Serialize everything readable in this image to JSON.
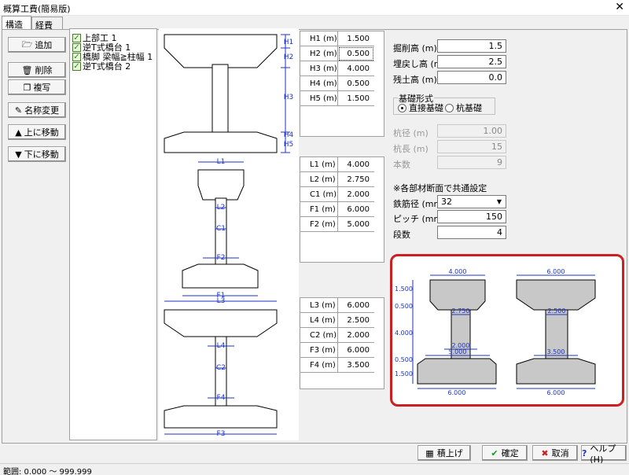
{
  "window": {
    "title": "概算工費(簡易版)",
    "close": "✕"
  },
  "tabs": [
    {
      "label": "構造物"
    },
    {
      "label": "経費率"
    }
  ],
  "buttons": {
    "add": "追加",
    "delete": "削除",
    "copy": "複写",
    "rename": "名称変更",
    "move_up": "上に移動",
    "move_down": "下に移動"
  },
  "tree": [
    {
      "label": "上部工 1"
    },
    {
      "label": "逆T式橋台 1"
    },
    {
      "label": "橋脚 梁幅≧柱幅 1"
    },
    {
      "label": "逆T式橋台 2"
    }
  ],
  "drawing_labels": {
    "h1": "H1",
    "h2": "H2",
    "h3": "H3",
    "h4": "H4",
    "h5": "H5",
    "l1": "L1",
    "l2": "L2",
    "c1": "C1",
    "f2": "F2",
    "f1": "F1",
    "l3": "L3",
    "l4": "L4",
    "c2": "C2",
    "f4": "F4",
    "f3": "F3"
  },
  "table_h": [
    {
      "label": "H1 (m)",
      "value": "1.500"
    },
    {
      "label": "H2 (m)",
      "value": "0.500"
    },
    {
      "label": "H3 (m)",
      "value": "4.000"
    },
    {
      "label": "H4 (m)",
      "value": "0.500"
    },
    {
      "label": "H5 (m)",
      "value": "1.500"
    }
  ],
  "table_l": [
    {
      "label": "L1 (m)",
      "value": "4.000"
    },
    {
      "label": "L2 (m)",
      "value": "2.750"
    },
    {
      "label": "C1 (m)",
      "value": "2.000"
    },
    {
      "label": "F1 (m)",
      "value": "6.000"
    },
    {
      "label": "F2 (m)",
      "value": "5.000"
    }
  ],
  "table_f": [
    {
      "label": "L3 (m)",
      "value": "6.000"
    },
    {
      "label": "L4 (m)",
      "value": "2.500"
    },
    {
      "label": "C2 (m)",
      "value": "2.000"
    },
    {
      "label": "F3 (m)",
      "value": "6.000"
    },
    {
      "label": "F4 (m)",
      "value": "3.500"
    }
  ],
  "fields": {
    "excavation_label": "掘削高 (m)",
    "excavation": "1.5",
    "backfill_label": "埋戻し高 (m)",
    "backfill": "2.5",
    "residual_label": "残土高 (m)",
    "residual": "0.0",
    "foundation_group": "基礎形式",
    "direct_label": "直接基礎",
    "pile_label": "杭基礎",
    "pile_dia_label": "杭径 (m)",
    "pile_dia": "1.00",
    "pile_len_label": "杭長 (m)",
    "pile_len": "15",
    "pile_count_label": "本数",
    "pile_count": "9",
    "common_note": "※各部材断面で共通設定",
    "rebar_label": "鉄筋径 (mm)",
    "rebar": "32",
    "pitch_label": "ピッチ (mm)",
    "pitch": "150",
    "tiers_label": "段数",
    "tiers": "4"
  },
  "preview": {
    "left": {
      "top_w": "4.000",
      "mid_w": "2.750",
      "col_w": "2.000",
      "foot_top": "5.000",
      "foot_w": "6.000",
      "h1": "1.500",
      "h2": "0.500",
      "h3": "4.000",
      "h4": "0.500",
      "h5": "1.500"
    },
    "right": {
      "top_w": "6.000",
      "mid_w": "2.500",
      "foot_top": "3.500",
      "foot_w": "6.000"
    }
  },
  "bottom_buttons": {
    "stack": "積上げ",
    "ok": "確定",
    "cancel": "取消",
    "help": "ヘルプ(H)"
  },
  "status": "範囲: 0.000 ～ 999.999"
}
